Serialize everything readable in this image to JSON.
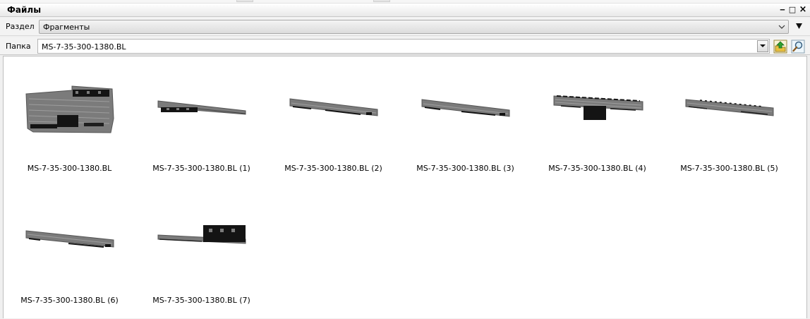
{
  "window": {
    "title": "Файлы",
    "buttons": {
      "minimize": "‒",
      "maximize": "□",
      "close": "×"
    }
  },
  "section": {
    "label": "Раздел",
    "value": "Фрагменты",
    "menu_icon": "triangle-down-icon"
  },
  "folder": {
    "label": "Папка",
    "value": "MS-7-35-300-1380.BL",
    "up_icon": "folder-up-icon",
    "search_icon": "magnifier-icon"
  },
  "colors": {
    "part_gray": "#7b7b7b",
    "part_dark": "#141414",
    "up_arrow_green": "#2fa12f",
    "folder_yellow": "#e8c040"
  },
  "files": [
    {
      "name": "MS-7-35-300-1380.BL",
      "shape": "block"
    },
    {
      "name": "MS-7-35-300-1380.BL (1)",
      "shape": "bar-left-box"
    },
    {
      "name": "MS-7-35-300-1380.BL (2)",
      "shape": "bar"
    },
    {
      "name": "MS-7-35-300-1380.BL (3)",
      "shape": "bar"
    },
    {
      "name": "MS-7-35-300-1380.BL (4)",
      "shape": "bar-center-box"
    },
    {
      "name": "MS-7-35-300-1380.BL (5)",
      "shape": "bar"
    },
    {
      "name": "MS-7-35-300-1380.BL (6)",
      "shape": "bar"
    },
    {
      "name": "MS-7-35-300-1380.BL (7)",
      "shape": "bar-right-box"
    }
  ]
}
